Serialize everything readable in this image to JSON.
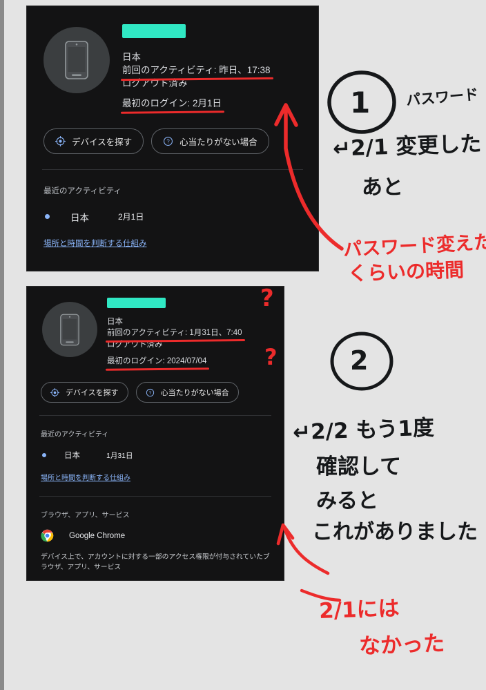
{
  "background_color": "#e4e4e4",
  "card_background": "#131314",
  "accent_blue": "#8ab4f8",
  "ink_red": "#ec2b2b",
  "redaction_color": "#30e8c4",
  "cards": [
    {
      "id": "device-card-1",
      "avatar_icon": "phone-icon",
      "device_name_redacted": true,
      "country": "日本",
      "last_activity": "前回のアクティビティ: 昨日、17:38",
      "session_state": "ログアウト済み",
      "first_signin": "最初のログイン: 2月1日",
      "buttons": [
        {
          "icon": "find-device-icon",
          "label": "デバイスを探す"
        },
        {
          "icon": "help-circle-icon",
          "label": "心当たりがない場合"
        }
      ],
      "recent_activity_label": "最近のアクティビティ",
      "activity": [
        {
          "place": "日本",
          "date": "2月1日"
        }
      ],
      "link_label": "場所と時間を判断する仕組み",
      "apps_section": null
    },
    {
      "id": "device-card-2",
      "avatar_icon": "phone-icon",
      "device_name_redacted": true,
      "country": "日本",
      "last_activity": "前回のアクティビティ: 1月31日、7:40",
      "session_state": "ログアウト済み",
      "first_signin": "最初のログイン: 2024/07/04",
      "buttons": [
        {
          "icon": "find-device-icon",
          "label": "デバイスを探す"
        },
        {
          "icon": "help-circle-icon",
          "label": "心当たりがない場合"
        }
      ],
      "recent_activity_label": "最近のアクティビティ",
      "activity": [
        {
          "place": "日本",
          "date": "1月31日"
        }
      ],
      "link_label": "場所と時間を判断する仕組み",
      "apps_section": {
        "label": "ブラウザ、アプリ、サービス",
        "apps": [
          {
            "icon": "chrome-icon",
            "name": "Google Chrome"
          }
        ],
        "note": "デバイス上で、アカウントに対する一部のアクセス権限が付与されていたブラウザ、アプリ、サービス"
      }
    }
  ],
  "annotations": {
    "marker_1": "1",
    "marker_2": "2",
    "black_1_line1": "パスワード",
    "black_1_line2": "↵2/1 変更した",
    "black_1_line3": "あと",
    "red_1_line1": "パスワード変えた",
    "red_1_line2": "くらいの時間",
    "black_2_line1": "↵2/2 もう1度",
    "black_2_line2": "確認して",
    "black_2_line3": "みると",
    "black_2_line4": "これがありました",
    "red_2_line1": "2/1には",
    "red_2_line2": "なかった",
    "question_mark_1": "?",
    "question_mark_2": "?"
  }
}
